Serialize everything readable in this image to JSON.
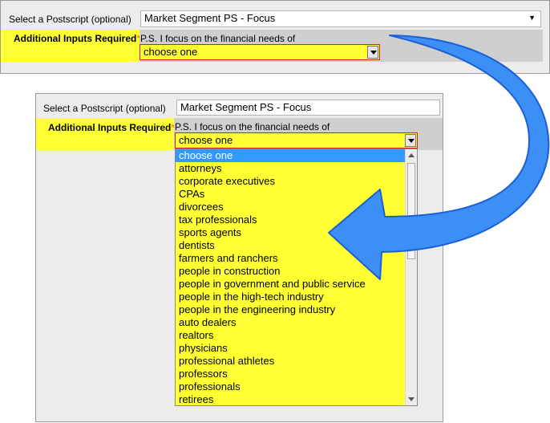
{
  "top_form": {
    "postscript_label": "Select a Postscript (optional)",
    "postscript_value": "Market Segment PS - Focus",
    "required_label": "Additional Inputs Required",
    "required_star": "*:",
    "ps_text": "P.S. I focus on the financial needs of",
    "choose_value": "choose one"
  },
  "bottom_form": {
    "postscript_label": "Select a Postscript (optional)",
    "postscript_value": "Market Segment PS - Focus",
    "required_label": "Additional Inputs Required",
    "required_star": "*:",
    "ps_text": "P.S. I focus on the financial needs of",
    "choose_value": "choose one",
    "options": [
      "choose one",
      "attorneys",
      "corporate executives",
      "CPAs",
      "divorcees",
      "tax professionals",
      "sports agents",
      "dentists",
      "farmers and ranchers",
      "people in construction",
      "people in government and public service",
      "people in the high-tech industry",
      "people in the engineering industry",
      "auto dealers",
      "realtors",
      "physicians",
      "professional athletes",
      "professors",
      "professionals",
      "retirees"
    ],
    "selected_option": "choose one"
  },
  "colors": {
    "highlight": "#ffff33",
    "selection": "#3399ff",
    "arrow": "#3b8ff5",
    "required_star": "#ff6600"
  }
}
